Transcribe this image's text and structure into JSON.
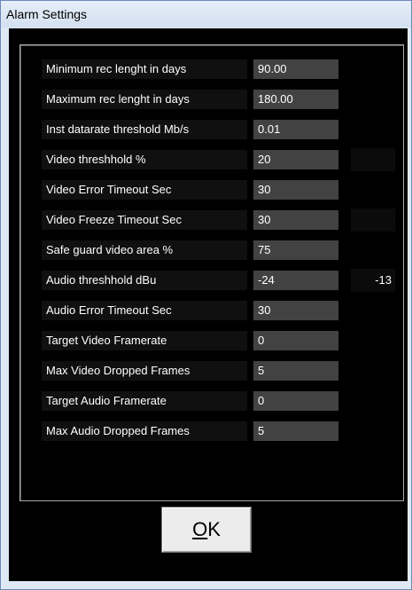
{
  "window": {
    "title": "Alarm Settings"
  },
  "settings": [
    {
      "label": "Minimum rec lenght in days",
      "value": "90.00"
    },
    {
      "label": "Maximum rec lenght in days",
      "value": "180.00"
    },
    {
      "label": "Inst datarate threshold Mb/s",
      "value": "0.01"
    },
    {
      "label": "Video threshhold %",
      "value": "20"
    },
    {
      "label": "Video Error Timeout Sec",
      "value": "30"
    },
    {
      "label": "Video Freeze Timeout Sec",
      "value": "30"
    },
    {
      "label": "Safe guard video area %",
      "value": "75"
    },
    {
      "label": "Audio threshhold dBu",
      "value": "-24"
    },
    {
      "label": "Audio Error Timeout Sec",
      "value": "30"
    },
    {
      "label": "Target Video Framerate",
      "value": "0"
    },
    {
      "label": "Max Video Dropped Frames",
      "value": "5"
    },
    {
      "label": "Target Audio Framerate",
      "value": "0"
    },
    {
      "label": "Max Audio Dropped Frames",
      "value": "5"
    }
  ],
  "extras": {
    "video_threshold_indicator": "",
    "video_freeze_indicator": "",
    "audio_threshold_indicator": "-13"
  },
  "buttons": {
    "ok_underlined": "O",
    "ok_rest": "K"
  },
  "colors": {
    "client_background": "#000000",
    "label_background": "#101010",
    "value_background": "#424242",
    "titlebar": "#dfe9f5"
  }
}
